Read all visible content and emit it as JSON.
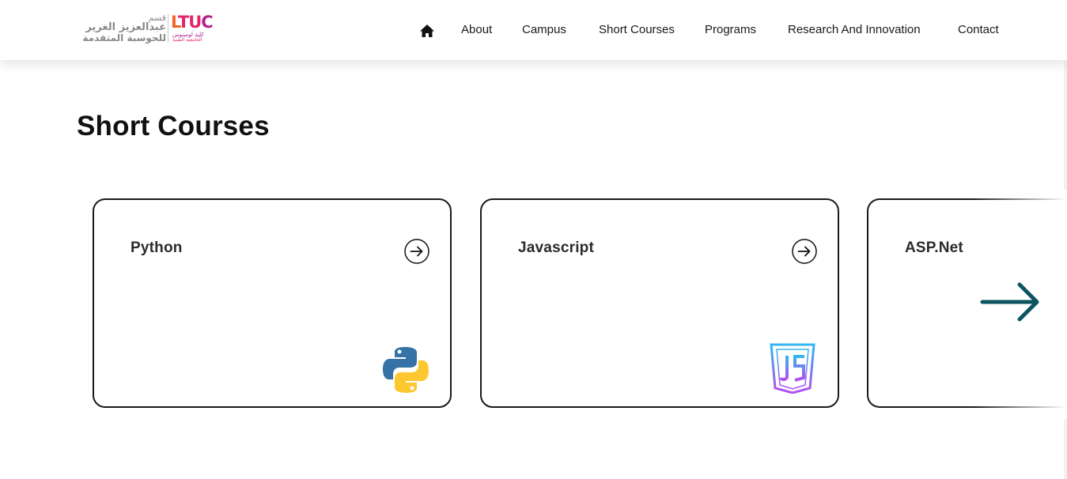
{
  "header": {
    "logo": {
      "arabic_line1": "قسم",
      "arabic_line2": "عبدالعزيز الغرير",
      "arabic_line3": "للحوسبة المتقدمة",
      "brand_l": "L",
      "brand_tu": "TU",
      "brand_c": "C",
      "brand_sub1": "كلية لومينوس",
      "brand_sub2": "الجامعية التقنية",
      "colors": {
        "orange": "#f26522",
        "pink": "#e3256b",
        "purple": "#b0228e",
        "gray": "#8a8a8a"
      }
    },
    "nav": {
      "home_icon": "home-icon",
      "items": [
        "About",
        "Campus",
        "Short Courses",
        "Programs",
        "Research And Innovation",
        "Contact"
      ]
    }
  },
  "main": {
    "title": "Short Courses",
    "cards": [
      {
        "title": "Python",
        "icon": "python-logo-icon",
        "arrow_icon": "arrow-right-circle-icon"
      },
      {
        "title": "Javascript",
        "icon": "javascript-logo-icon",
        "arrow_icon": "arrow-right-circle-icon"
      },
      {
        "title": "ASP.Net"
      }
    ],
    "next_icon": "arrow-right-icon",
    "next_color": "#0c5560"
  }
}
